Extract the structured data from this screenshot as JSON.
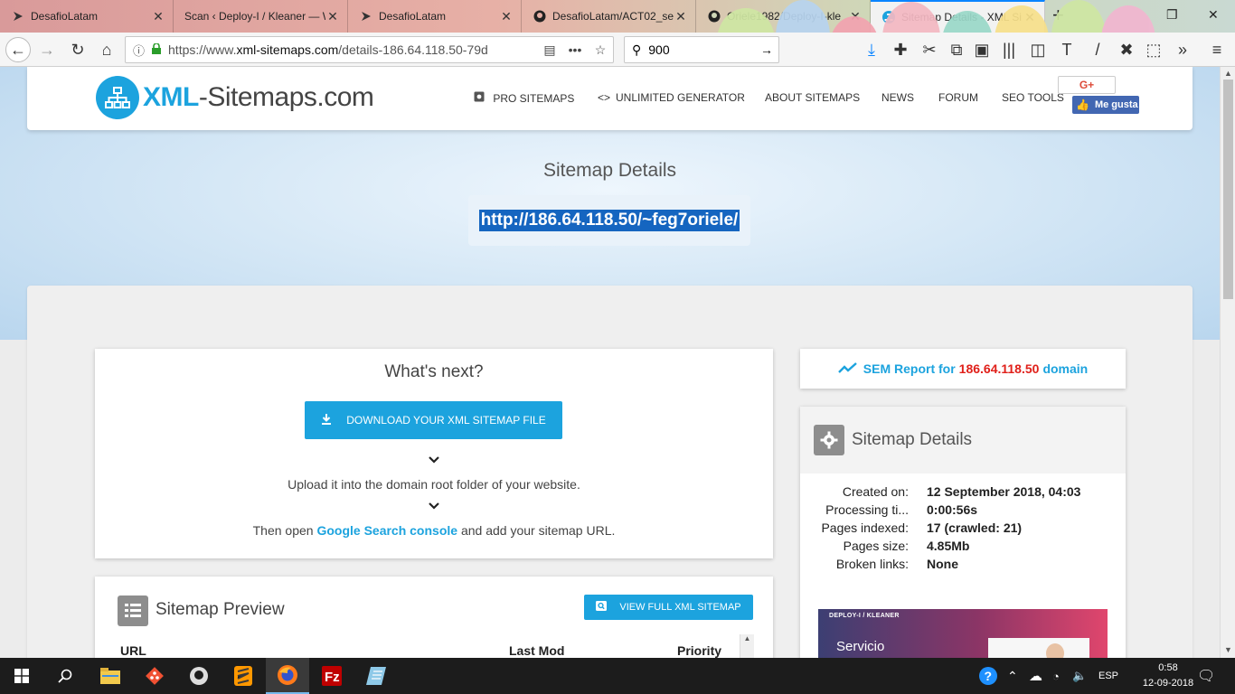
{
  "browser": {
    "tabs": [
      {
        "label": "DesafioLatam",
        "icon": "desafio-icon",
        "active": false
      },
      {
        "label": "Scan ‹ Deploy-I / Kleaner — W",
        "icon": "wordpress-icon",
        "active": false
      },
      {
        "label": "DesafioLatam",
        "icon": "desafio-icon",
        "active": false
      },
      {
        "label": "DesafioLatam/ACT02_se",
        "icon": "github-icon",
        "active": false
      },
      {
        "label": "Oriele1982/Deploy-I-kle",
        "icon": "github-icon",
        "active": false
      },
      {
        "label": "Sitemap Details - XML Si",
        "icon": "xml-sitemaps-icon",
        "active": true
      }
    ],
    "url_prefix": "https://www.",
    "url_domain": "xml-sitemaps.com",
    "url_rest": "/details-186.64.118.50-79d",
    "search_value": "900"
  },
  "site": {
    "logo_part1": "XML",
    "logo_part2": "-Sitemaps.com",
    "menu": [
      {
        "label": "PRO SITEMAPS",
        "icon": "pro-icon"
      },
      {
        "label": "UNLIMITED GENERATOR",
        "icon": "code-icon"
      },
      {
        "label": "ABOUT SITEMAPS",
        "icon": ""
      },
      {
        "label": "NEWS",
        "icon": ""
      },
      {
        "label": "FORUM",
        "icon": ""
      },
      {
        "label": "SEO TOOLS",
        "icon": ""
      }
    ],
    "gplus": "G+",
    "fb_like": "Me gusta"
  },
  "hero": {
    "title": "Sitemap Details",
    "url": "http://186.64.118.50/~feg7oriele/"
  },
  "next": {
    "title": "What's next?",
    "download_label": "DOWNLOAD YOUR XML SITEMAP FILE",
    "step1": "Upload it into the domain root folder of your website.",
    "step2_prefix": "Then open ",
    "step2_link": "Google Search console",
    "step2_suffix": " and add your sitemap URL."
  },
  "preview": {
    "title": "Sitemap Preview",
    "view_label": "VIEW FULL XML SITEMAP",
    "columns": [
      "URL",
      "Last Mod",
      "Priority"
    ]
  },
  "sem": {
    "prefix": "SEM Report for",
    "ip": "186.64.118.50",
    "suffix": "domain"
  },
  "details": {
    "title": "Sitemap Details",
    "rows": [
      {
        "key": "Created on:",
        "value": "12 September 2018, 04:03"
      },
      {
        "key": "Processing ti...",
        "value": "0:00:56s"
      },
      {
        "key": "Pages indexed:",
        "value": "17 (crawled: 21)"
      },
      {
        "key": "Pages size:",
        "value": "4.85Mb"
      },
      {
        "key": "Broken links:",
        "value": "None"
      }
    ]
  },
  "promo": {
    "top": "DEPLOY-I / KLEANER",
    "main": "Servicio"
  },
  "taskbar": {
    "lang": "ESP",
    "time": "0:58",
    "date": "12-09-2018"
  },
  "colors": {
    "brand": "#1ca3de",
    "ip_red": "#e0201a",
    "selection": "#1565c0"
  }
}
